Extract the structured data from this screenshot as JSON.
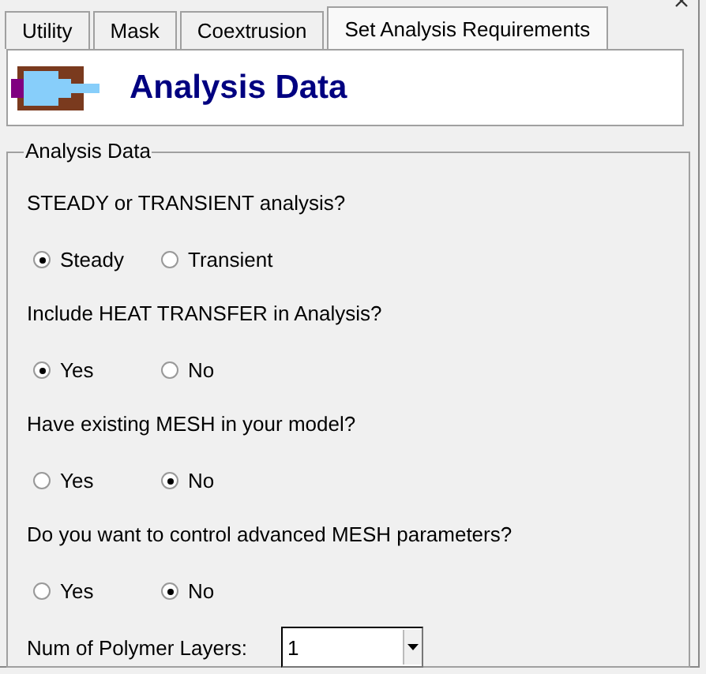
{
  "tabs": [
    {
      "label": "Utility",
      "selected": false
    },
    {
      "label": "Mask",
      "selected": false
    },
    {
      "label": "Coextrusion",
      "selected": false
    },
    {
      "label": "Set Analysis Requirements",
      "selected": true
    }
  ],
  "header": {
    "title": "Analysis Data"
  },
  "group": {
    "legend": "Analysis Data",
    "questions": [
      {
        "label": "STEADY or TRANSIENT analysis?",
        "options": [
          {
            "label": "Steady",
            "selected": true
          },
          {
            "label": "Transient",
            "selected": false
          }
        ]
      },
      {
        "label": "Include HEAT TRANSFER in Analysis?",
        "options": [
          {
            "label": "Yes",
            "selected": true
          },
          {
            "label": "No",
            "selected": false
          }
        ]
      },
      {
        "label": "Have existing MESH in your model?",
        "options": [
          {
            "label": "Yes",
            "selected": false
          },
          {
            "label": "No",
            "selected": true
          }
        ]
      },
      {
        "label": "Do you want to control advanced MESH parameters?",
        "options": [
          {
            "label": "Yes",
            "selected": false
          },
          {
            "label": "No",
            "selected": true
          }
        ]
      }
    ],
    "layers": {
      "label": "Num of Polymer Layers:",
      "value": "1"
    }
  }
}
